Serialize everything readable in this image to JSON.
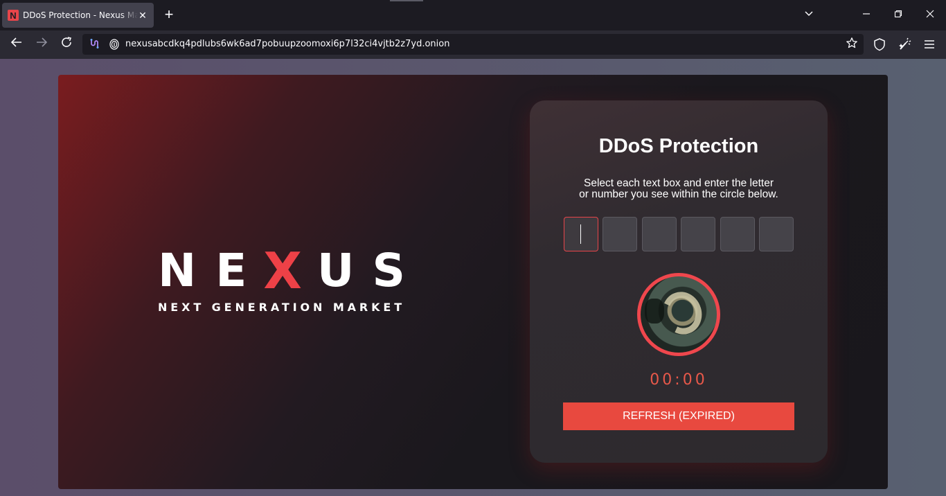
{
  "browser": {
    "tab": {
      "title": "DDoS Protection - Nexus Market",
      "favicon_letter": "N"
    },
    "url": "nexusabcdkq4pdlubs6wk6ad7pobuupzoomoxi6p7l32ci4vjtb2z7yd.onion",
    "icons": [
      "back-icon",
      "forward-icon",
      "reload-icon",
      "onion-circuit-icon",
      "fingerprint-icon",
      "star-icon",
      "shield-icon",
      "new-identity-icon",
      "menu-icon",
      "minimize-icon",
      "restore-icon",
      "close-icon",
      "chevron-down-icon"
    ]
  },
  "brand": {
    "letters": [
      "N",
      "E",
      "X",
      "U",
      "S"
    ],
    "tagline": "NEXT GENERATION MARKET",
    "accent_color": "#ee4147"
  },
  "captcha_card": {
    "title": "DDoS Protection",
    "instruction_line1": "Select each text box and enter the letter",
    "instruction_line2": "or number you see within the circle below.",
    "inputs": [
      "",
      "",
      "",
      "",
      "",
      ""
    ],
    "timer": "00:00",
    "refresh_label": "REFRESH (EXPIRED)",
    "button_color": "#e8493f"
  }
}
